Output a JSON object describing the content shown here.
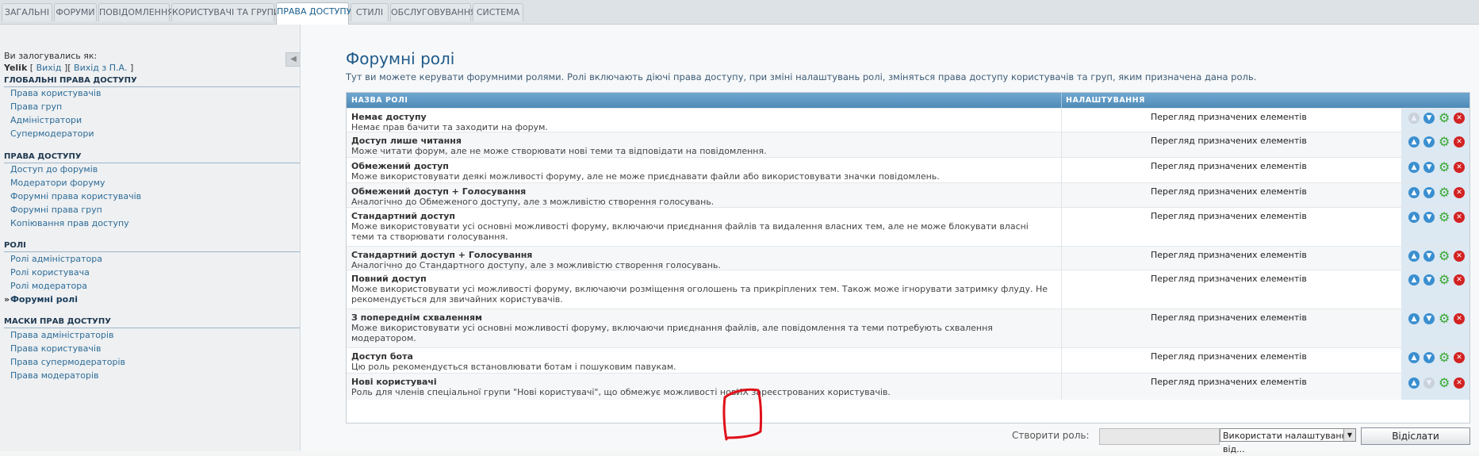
{
  "tabs": [
    "Загальні",
    "Форуми",
    "Повідомлення",
    "Користувачі та групи",
    "Права доступу",
    "Стилі",
    "Обслуговування",
    "Система"
  ],
  "active_tab": "Права доступу",
  "sidebar": {
    "login_label": "Ви залогувались як:",
    "username": "Yelik",
    "logout": "Вихід",
    "logout_admin": "Вихід з П.А.",
    "sections": [
      {
        "title": "Глобальні права доступу",
        "items": [
          "Права користувачів",
          "Права груп",
          "Адміністратори",
          "Супермодератори"
        ]
      },
      {
        "title": "Права доступу",
        "items": [
          "Доступ до форумів",
          "Модератори форуму",
          "Форумні права користувачів",
          "Форумні права груп",
          "Копіювання прав доступу"
        ]
      },
      {
        "title": "Ролі",
        "items": [
          "Ролі адміністратора",
          "Ролі користувача",
          "Ролі модератора",
          "Форумні ролі"
        ]
      },
      {
        "title": "Маски прав доступу",
        "items": [
          "Права адміністраторів",
          "Права користувачів",
          "Права супермодераторів",
          "Права модераторів"
        ]
      }
    ],
    "active_item": "Форумні ролі"
  },
  "main": {
    "title": "Форумні ролі",
    "description": "Тут ви можете керувати форумними ролями. Ролі включають діючі права доступу, при зміні налаштувань ролі, зміняться права доступу користувачів та груп, яким призначена дана роль.",
    "col_name": "Назва ролі",
    "col_settings": "Налаштування",
    "view_label": "Перегляд призначених елементів",
    "roles": [
      {
        "name": "Немає доступу",
        "desc": "Немає прав бачити та заходити на форум.",
        "up_disabled": true,
        "down_disabled": false
      },
      {
        "name": "Доступ лише читання",
        "desc": "Може читати форум, але не може створювати нові теми та відповідати на повідомлення.",
        "up_disabled": false,
        "down_disabled": false
      },
      {
        "name": "Обмежений доступ",
        "desc": "Може використовувати деякі можливості форуму, але не може приєднавати файли або використовувати значки повідомлень.",
        "up_disabled": false,
        "down_disabled": false
      },
      {
        "name": "Обмежений доступ + Голосування",
        "desc": "Аналогічно до Обмеженого доступу, але з можливістю створення голосувань.",
        "up_disabled": false,
        "down_disabled": false
      },
      {
        "name": "Стандартний доступ",
        "desc": "Може використовувати усі основні можливості форуму, включаючи приєднання файлів та видалення власних тем, але не може блокувати власні теми та створювати голосування.",
        "up_disabled": false,
        "down_disabled": false
      },
      {
        "name": "Стандартний доступ + Голосування",
        "desc": "Аналогічно до Стандартного доступу, але з можливістю створення голосувань.",
        "up_disabled": false,
        "down_disabled": false
      },
      {
        "name": "Повний доступ",
        "desc": "Може використовувати усі можливості форуму, включаючи розміщення оголошень та прикріплених тем. Також може ігнорувати затримку флуду. Не рекомендується для звичайних користувачів.",
        "up_disabled": false,
        "down_disabled": false
      },
      {
        "name": "З попереднім схваленням",
        "desc": "Може використовувати усі основні можливості форуму, включаючи приєднання файлів, але повідомлення та теми потребують схвалення модератором.",
        "up_disabled": false,
        "down_disabled": false
      },
      {
        "name": "Доступ бота",
        "desc": "Цю роль рекомендується встановлювати ботам і пошуковим павукам.",
        "up_disabled": false,
        "down_disabled": false
      },
      {
        "name": "Нові користувачі",
        "desc": "Роль для членів спеціальної групи \"Нові користувачі\", що обмежує можливості новИХ зареєстрованих користувачів.",
        "up_disabled": false,
        "down_disabled": true
      }
    ],
    "create_label": "Створити роль:",
    "create_value": "",
    "select_value": "Використати налаштування від...",
    "submit_label": "Відіслати"
  },
  "colors": {
    "accent": "#1f5a8a",
    "header": "#5b96c2",
    "link": "#2e6c97",
    "delete": "#d32222",
    "gear": "#3aa834",
    "mark": "#e0101a"
  }
}
